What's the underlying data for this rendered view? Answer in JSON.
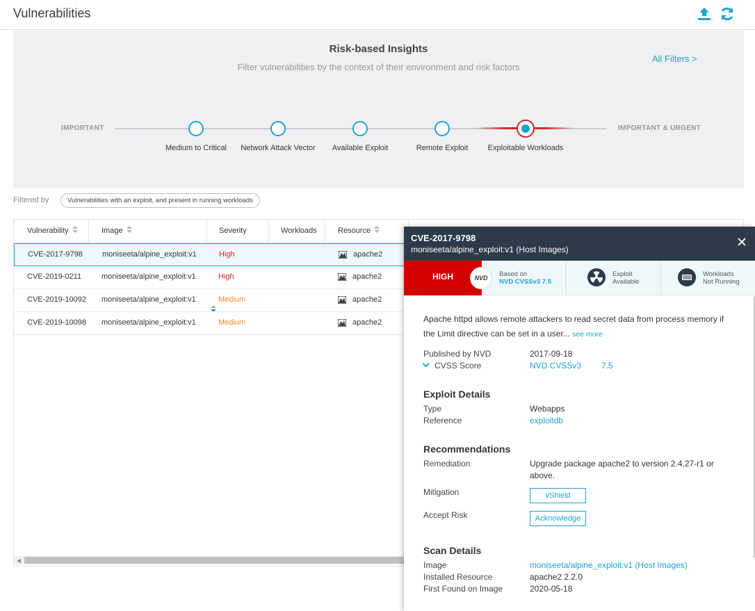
{
  "header": {
    "title": "Vulnerabilities",
    "export_icon": "upload-icon",
    "refresh_icon": "refresh-icon"
  },
  "insights": {
    "title": "Risk-based Insights",
    "subtitle": "Filter vulnerabilities by the context of their environment and risk factors",
    "all_filters": "All Filters >",
    "scale_left": "IMPORTANT",
    "scale_right": "IMPORTANT & URGENT",
    "stops": [
      {
        "label": "Medium to Critical",
        "active": false
      },
      {
        "label": "Network Attack Vector",
        "active": false
      },
      {
        "label": "Available Exploit",
        "active": false
      },
      {
        "label": "Remote Exploit",
        "active": false
      },
      {
        "label": "Exploitable Workloads",
        "active": true
      }
    ]
  },
  "filter": {
    "label": "Filtered by",
    "chip": "Vulnerabilities with an exploit, and present in running workloads"
  },
  "table": {
    "columns": [
      "Vulnerability",
      "Image",
      "Severity",
      "Workloads",
      "Resource"
    ],
    "rows": [
      {
        "vulnerability": "CVE-2017-9798",
        "image": "moniseeta/alpine_exploit:v1",
        "severity": "High",
        "workloads": "",
        "resource": "apache2"
      },
      {
        "vulnerability": "CVE-2019-0211",
        "image": "moniseeta/alpine_exploit:v1",
        "severity": "High",
        "workloads": "",
        "resource": "apache2"
      },
      {
        "vulnerability": "CVE-2019-10092",
        "image": "moniseeta/alpine_exploit:v1",
        "severity": "Medium",
        "workloads": "",
        "resource": "apache2"
      },
      {
        "vulnerability": "CVE-2019-10098",
        "image": "moniseeta/alpine_exploit:v1",
        "severity": "Medium",
        "workloads": "",
        "resource": "apache2"
      }
    ]
  },
  "panel": {
    "cve": "CVE-2017-9798",
    "image": "moniseeta/alpine_exploit:v1 (Host Images)",
    "severity": "HIGH",
    "nvd_badge": "NVD",
    "based_on_label": "Based on",
    "based_on_value": "NVD CVSSv3 7.5",
    "exploit_line1": "Exploit",
    "exploit_line2": "Available",
    "workloads_line1": "Workloads",
    "workloads_line2": "Not Running",
    "description": "Apache httpd allows remote attackers to read secret data from process memory if the Limit directive can be set in a user...",
    "see_more": "see more",
    "published_label": "Published by NVD",
    "published_value": "2017-09-18",
    "cvss_label": "CVSS Score",
    "cvss_source": "NVD CVSSv3",
    "cvss_value": "7.5",
    "exploit_title": "Exploit Details",
    "type_label": "Type",
    "type_value": "Webapps",
    "reference_label": "Reference",
    "reference_value": "exploitdb",
    "recommendations_title": "Recommendations",
    "remediation_label": "Remediation",
    "remediation_line1": "Upgrade package apache2 to version 2.4.27-r1 or",
    "remediation_line2": "above.",
    "mitigation_label": "Mitigation",
    "mitigation_button": "vShield",
    "accept_label": "Accept Risk",
    "accept_button": "Acknowledge",
    "scan_title": "Scan Details",
    "scan_image_label": "Image",
    "scan_image_value": "moniseeta/alpine_exploit:v1 (Host Images)",
    "installed_label": "Installed Resource",
    "installed_value": "apache2 2.2.0",
    "first_found_label": "First Found on Image",
    "first_found_value": "2020-05-18"
  },
  "colors": {
    "accent": "#1ba3d1",
    "high": "#c92a2a",
    "medium": "#ef8a2c",
    "severity_box": "#d10000",
    "panel_header": "#2d3a4a"
  }
}
